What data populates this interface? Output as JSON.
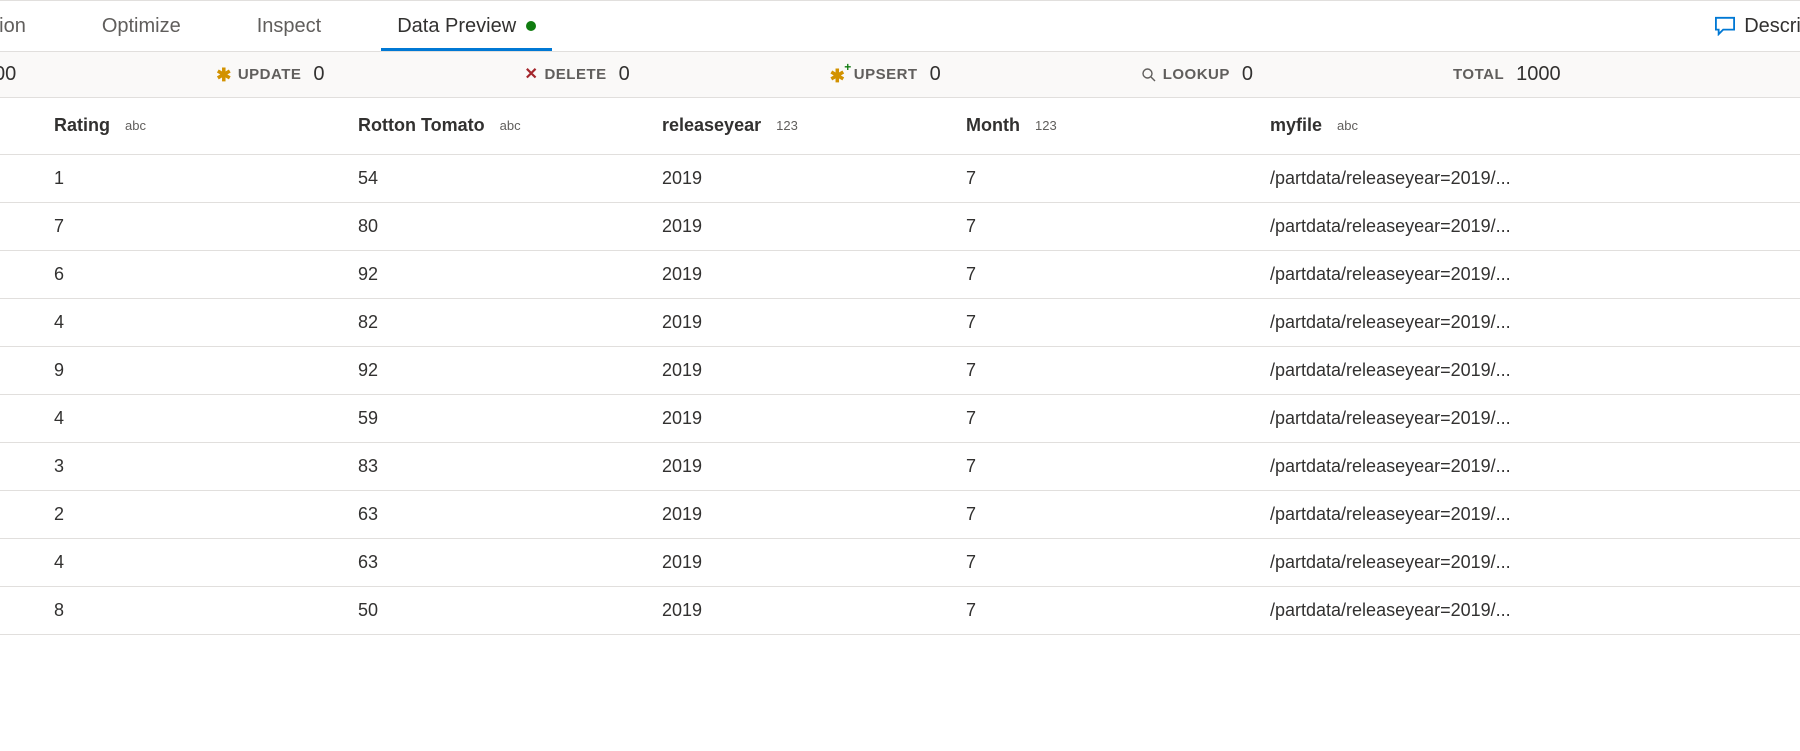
{
  "tabs": {
    "projection": "jection",
    "optimize": "Optimize",
    "inspect": "Inspect",
    "data_preview": "Data Preview",
    "description_btn": "Descrip"
  },
  "stats": {
    "leading_number": "00",
    "update": {
      "label": "UPDATE",
      "value": "0"
    },
    "delete": {
      "label": "DELETE",
      "value": "0"
    },
    "upsert": {
      "label": "UPSERT",
      "value": "0"
    },
    "lookup": {
      "label": "LOOKUP",
      "value": "0"
    },
    "total": {
      "label": "TOTAL",
      "value": "1000"
    }
  },
  "columns": [
    {
      "name": "Rating",
      "type": "abc"
    },
    {
      "name": "Rotton Tomato",
      "type": "abc"
    },
    {
      "name": "releaseyear",
      "type": "123"
    },
    {
      "name": "Month",
      "type": "123"
    },
    {
      "name": "myfile",
      "type": "abc"
    }
  ],
  "rows": [
    {
      "rating": "1",
      "rotten": "54",
      "year": "2019",
      "month": "7",
      "file": "/partdata/releaseyear=2019/..."
    },
    {
      "rating": "7",
      "rotten": "80",
      "year": "2019",
      "month": "7",
      "file": "/partdata/releaseyear=2019/..."
    },
    {
      "rating": "6",
      "rotten": "92",
      "year": "2019",
      "month": "7",
      "file": "/partdata/releaseyear=2019/..."
    },
    {
      "rating": "4",
      "rotten": "82",
      "year": "2019",
      "month": "7",
      "file": "/partdata/releaseyear=2019/..."
    },
    {
      "rating": "9",
      "rotten": "92",
      "year": "2019",
      "month": "7",
      "file": "/partdata/releaseyear=2019/..."
    },
    {
      "rating": "4",
      "rotten": "59",
      "year": "2019",
      "month": "7",
      "file": "/partdata/releaseyear=2019/..."
    },
    {
      "rating": "3",
      "rotten": "83",
      "year": "2019",
      "month": "7",
      "file": "/partdata/releaseyear=2019/..."
    },
    {
      "rating": "2",
      "rotten": "63",
      "year": "2019",
      "month": "7",
      "file": "/partdata/releaseyear=2019/..."
    },
    {
      "rating": "4",
      "rotten": "63",
      "year": "2019",
      "month": "7",
      "file": "/partdata/releaseyear=2019/..."
    },
    {
      "rating": "8",
      "rotten": "50",
      "year": "2019",
      "month": "7",
      "file": "/partdata/releaseyear=2019/..."
    }
  ]
}
